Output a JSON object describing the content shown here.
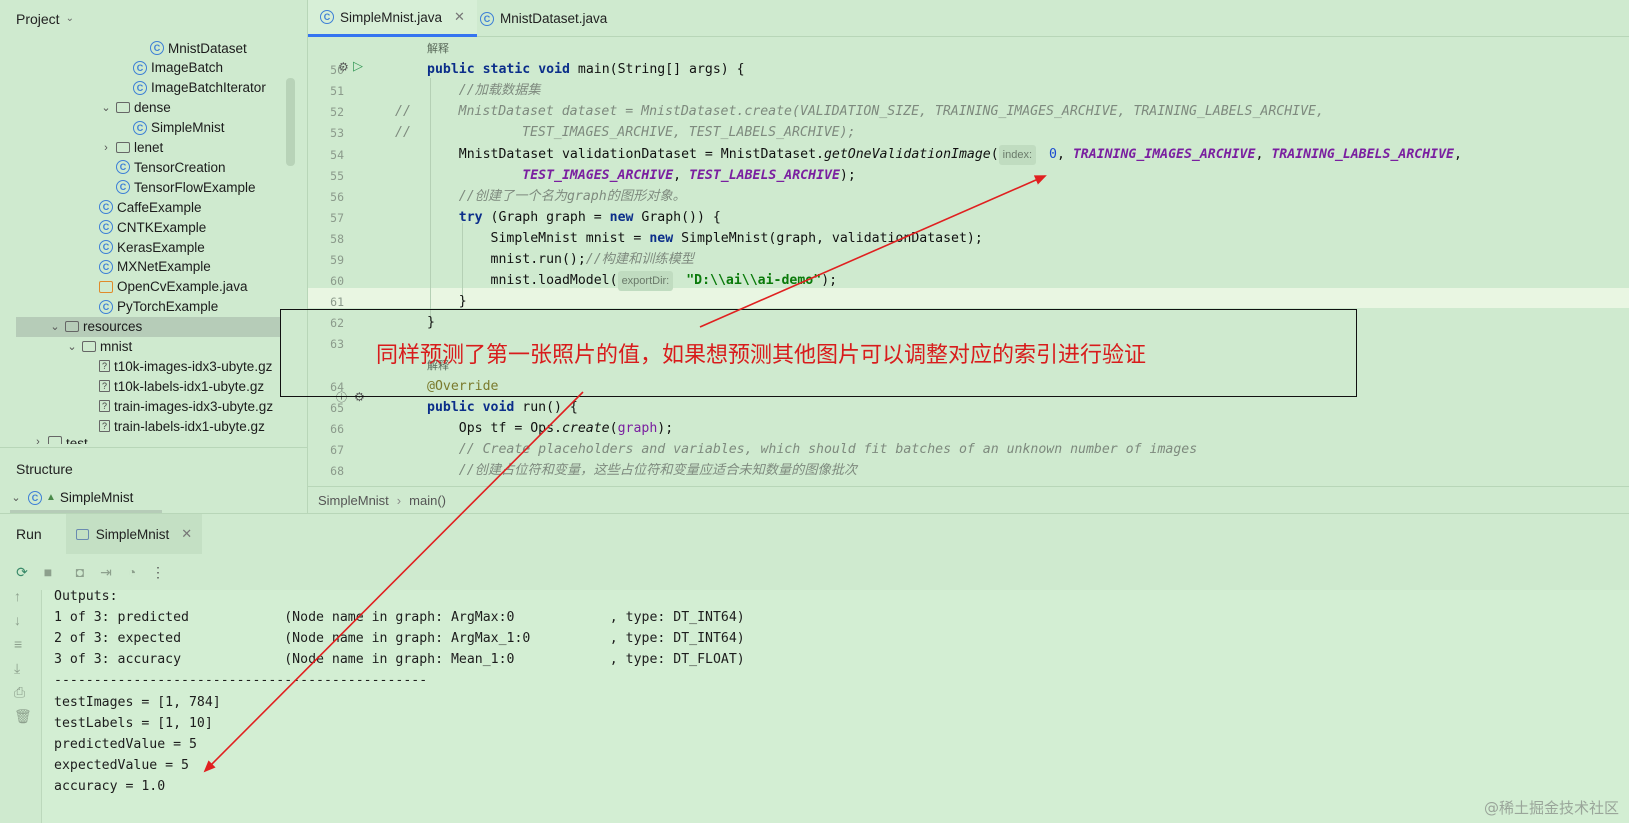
{
  "project_panel": {
    "title": "Project",
    "tree": [
      {
        "label": "MnistDataset",
        "icon": "class-icon",
        "indent": 4,
        "chev": ""
      },
      {
        "label": "ImageBatch",
        "icon": "class-icon",
        "indent": 3,
        "chev": ""
      },
      {
        "label": "ImageBatchIterator",
        "icon": "class-icon",
        "indent": 3,
        "chev": ""
      },
      {
        "label": "dense",
        "icon": "folder-icon",
        "indent": 2,
        "chev": "⌄"
      },
      {
        "label": "SimpleMnist",
        "icon": "class-icon",
        "indent": 3,
        "chev": ""
      },
      {
        "label": "lenet",
        "icon": "folder-icon",
        "indent": 2,
        "chev": "›"
      },
      {
        "label": "TensorCreation",
        "icon": "class-icon",
        "indent": 2,
        "chev": ""
      },
      {
        "label": "TensorFlowExample",
        "icon": "class-icon",
        "indent": 2,
        "chev": ""
      },
      {
        "label": "CaffeExample",
        "icon": "class-icon",
        "indent": 1,
        "chev": ""
      },
      {
        "label": "CNTKExample",
        "icon": "class-icon",
        "indent": 1,
        "chev": ""
      },
      {
        "label": "KerasExample",
        "icon": "class-icon",
        "indent": 1,
        "chev": ""
      },
      {
        "label": "MXNetExample",
        "icon": "class-icon",
        "indent": 1,
        "chev": ""
      },
      {
        "label": "OpenCvExample.java",
        "icon": "java-file-icon",
        "indent": 1,
        "chev": ""
      },
      {
        "label": "PyTorchExample",
        "icon": "class-icon",
        "indent": 1,
        "chev": ""
      },
      {
        "label": "resources",
        "icon": "resources-folder-icon",
        "indent": -1,
        "chev": "⌄",
        "selected": true
      },
      {
        "label": "mnist",
        "icon": "folder-icon",
        "indent": 0,
        "chev": "⌄"
      },
      {
        "label": "t10k-images-idx3-ubyte.gz",
        "icon": "unknown-file-icon",
        "indent": 1,
        "chev": ""
      },
      {
        "label": "t10k-labels-idx1-ubyte.gz",
        "icon": "unknown-file-icon",
        "indent": 1,
        "chev": ""
      },
      {
        "label": "train-images-idx3-ubyte.gz",
        "icon": "unknown-file-icon",
        "indent": 1,
        "chev": ""
      },
      {
        "label": "train-labels-idx1-ubyte.gz",
        "icon": "unknown-file-icon",
        "indent": 1,
        "chev": ""
      },
      {
        "label": "test",
        "icon": "folder-icon",
        "indent": -2,
        "chev": "›",
        "cut": true
      }
    ]
  },
  "structure_panel": {
    "title": "Structure",
    "root": "SimpleMnist"
  },
  "editor": {
    "tabs": [
      {
        "label": "SimpleMnist.java",
        "active": true,
        "closable": true
      },
      {
        "label": "MnistDataset.java",
        "active": false,
        "closable": false
      }
    ],
    "lines": [
      {
        "num": "",
        "text": "解释",
        "style": "small"
      },
      {
        "num": "50",
        "text": "public static void main(String[] args) {",
        "style": "code"
      },
      {
        "num": "51",
        "text": "    //加载数据集",
        "style": "comment"
      },
      {
        "num": "52",
        "text": "//      MnistDataset dataset = MnistDataset.create(VALIDATION_SIZE, TRAINING_IMAGES_ARCHIVE, TRAINING_LABELS_ARCHIVE,",
        "style": "comment",
        "prefix_col": -4
      },
      {
        "num": "53",
        "text": "//              TEST_IMAGES_ARCHIVE, TEST_LABELS_ARCHIVE);",
        "style": "comment",
        "prefix_col": -4
      },
      {
        "num": "54",
        "text": "    MnistDataset validationDataset = MnistDataset.getOneValidationImage(",
        "hint": "index:",
        "after": " 0, TRAINING_IMAGES_ARCHIVE, TRAINING_LABELS_ARCHIVE,",
        "style": "code"
      },
      {
        "num": "55",
        "text": "            TEST_IMAGES_ARCHIVE, TEST_LABELS_ARCHIVE);",
        "style": "code"
      },
      {
        "num": "56",
        "text": "    //创建了一个名为graph的图形对象。",
        "style": "comment"
      },
      {
        "num": "57",
        "text": "    try (Graph graph = new Graph()) {",
        "style": "code"
      },
      {
        "num": "58",
        "text": "        SimpleMnist mnist = new SimpleMnist(graph, validationDataset);",
        "style": "code"
      },
      {
        "num": "59",
        "text": "        mnist.run();//构建和训练模型",
        "style": "code"
      },
      {
        "num": "60",
        "text": "        mnist.loadModel(",
        "hint": "exportDir:",
        "after": " \"D:\\\\ai\\\\ai-demo\");",
        "style": "code"
      },
      {
        "num": "61",
        "text": "    }",
        "style": "code"
      },
      {
        "num": "62",
        "text": "}",
        "style": "code"
      },
      {
        "num": "63",
        "text": "",
        "style": "code"
      },
      {
        "num": "",
        "text": "解释",
        "style": "small"
      },
      {
        "num": "64",
        "text": "@Override",
        "style": "annot"
      },
      {
        "num": "65",
        "text": "public void run() {",
        "style": "code"
      },
      {
        "num": "66",
        "text": "    Ops tf = Ops.create(graph);",
        "style": "code"
      },
      {
        "num": "67",
        "text": "    // Create placeholders and variables, which should fit batches of an unknown number of images",
        "style": "comment"
      },
      {
        "num": "68",
        "text": "    //创建占位符和变量，这些占位符和变量应适合未知数量的图像批次",
        "style": "comment"
      }
    ],
    "breadcrumb": [
      "SimpleMnist",
      "main()"
    ]
  },
  "annotation": {
    "text": "同样预测了第一张照片的值，如果想预测其他图片可以调整对应的索引进行验证",
    "color": "#d81c1c"
  },
  "run_panel": {
    "title": "Run",
    "tab_label": "SimpleMnist",
    "toolbar": [
      "rerun-icon",
      "stop-icon",
      "camera-icon",
      "exit-icon",
      "coverage-icon",
      "more-icon"
    ],
    "side_tools": [
      "up-arrow-icon",
      "down-arrow-icon",
      "soft-wrap-icon",
      "scroll-to-end-icon",
      "print-icon",
      "trash-icon"
    ],
    "console": [
      "Outputs:",
      "1 of 3: predicted            (Node name in graph: ArgMax:0            , type: DT_INT64)",
      "2 of 3: expected             (Node name in graph: ArgMax_1:0          , type: DT_INT64)",
      "3 of 3: accuracy             (Node name in graph: Mean_1:0            , type: DT_FLOAT)",
      "-----------------------------------------------",
      "testImages = [1, 784]",
      "testLabels = [1, 10]",
      "predictedValue = 5",
      "expectedValue = 5",
      "accuracy = 1.0"
    ]
  },
  "watermark": "@稀土掘金技术社区",
  "colors": {
    "background": "#cfeacf",
    "accent": "#3574f0",
    "keyword": "#0b2e8a",
    "constant": "#7a1fa0",
    "string": "#0a7a0a",
    "annotation_red": "#d81c1c"
  }
}
